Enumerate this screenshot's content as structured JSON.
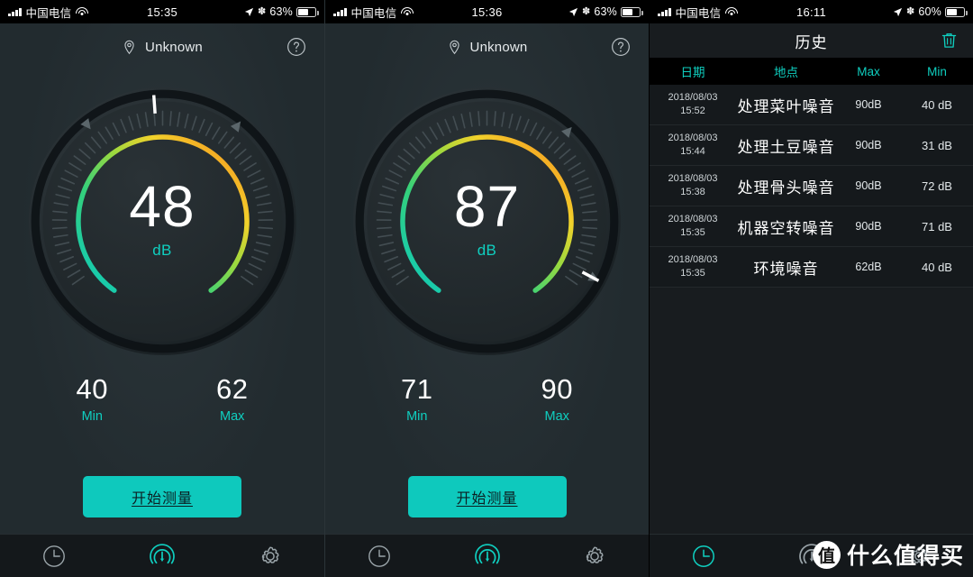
{
  "accent": "#0fcfc0",
  "panels": [
    {
      "status": {
        "carrier": "中国电信",
        "time": "15:35",
        "battery": "63%",
        "signal_icon": "signal-bars-icon",
        "wifi_icon": "wifi-icon",
        "location_icon": "location-arrow-icon",
        "bluetooth_icon": "bluetooth-icon",
        "battery_icon": "battery-icon"
      },
      "header": {
        "location": "Unknown",
        "pin_icon": "location-pin-icon",
        "help_icon": "help-circle-icon"
      },
      "gauge": {
        "value": "48",
        "unit": "dB",
        "value_num": 48,
        "needle_angle": -4
      },
      "min": {
        "value": "40",
        "label": "Min"
      },
      "max": {
        "value": "62",
        "label": "Max"
      },
      "action": "开始测量",
      "tabs": [
        {
          "name": "tab-history",
          "icon": "clock-icon",
          "active": false
        },
        {
          "name": "tab-meter",
          "icon": "gauge-icon",
          "active": true
        },
        {
          "name": "tab-settings",
          "icon": "gear-icon",
          "active": false
        }
      ]
    },
    {
      "status": {
        "carrier": "中国电信",
        "time": "15:36",
        "battery": "63%"
      },
      "header": {
        "location": "Unknown",
        "pin_icon": "location-pin-icon",
        "help_icon": "help-circle-icon"
      },
      "gauge": {
        "value": "87",
        "unit": "dB",
        "value_num": 87,
        "needle_angle": 118
      },
      "min": {
        "value": "71",
        "label": "Min"
      },
      "max": {
        "value": "90",
        "label": "Max"
      },
      "action": "开始测量",
      "tabs": [
        {
          "name": "tab-history",
          "icon": "clock-icon",
          "active": false
        },
        {
          "name": "tab-meter",
          "icon": "gauge-icon",
          "active": true
        },
        {
          "name": "tab-settings",
          "icon": "gear-icon",
          "active": false
        }
      ]
    }
  ],
  "history": {
    "status": {
      "carrier": "中国电信",
      "time": "16:11",
      "battery": "60%"
    },
    "title": "历史",
    "delete_icon": "trash-icon",
    "columns": {
      "date": "日期",
      "place": "地点",
      "max": "Max",
      "min": "Min"
    },
    "rows": [
      {
        "date1": "2018/08/03",
        "date2": "15:52",
        "place": "处理菜叶噪音",
        "max": "90dB",
        "min": "40 dB"
      },
      {
        "date1": "2018/08/03",
        "date2": "15:44",
        "place": "处理土豆噪音",
        "max": "90dB",
        "min": "31 dB"
      },
      {
        "date1": "2018/08/03",
        "date2": "15:38",
        "place": "处理骨头噪音",
        "max": "90dB",
        "min": "72 dB"
      },
      {
        "date1": "2018/08/03",
        "date2": "15:35",
        "place": "机器空转噪音",
        "max": "90dB",
        "min": "71 dB"
      },
      {
        "date1": "2018/08/03",
        "date2": "15:35",
        "place": "环境噪音",
        "max": "62dB",
        "min": "40 dB"
      }
    ],
    "tabs": [
      {
        "name": "tab-history",
        "icon": "clock-icon",
        "active": true
      },
      {
        "name": "tab-meter",
        "icon": "gauge-icon",
        "active": false
      },
      {
        "name": "tab-settings",
        "icon": "gear-icon",
        "active": false
      }
    ]
  },
  "watermark": {
    "badge": "值",
    "text": "什么值得买"
  }
}
